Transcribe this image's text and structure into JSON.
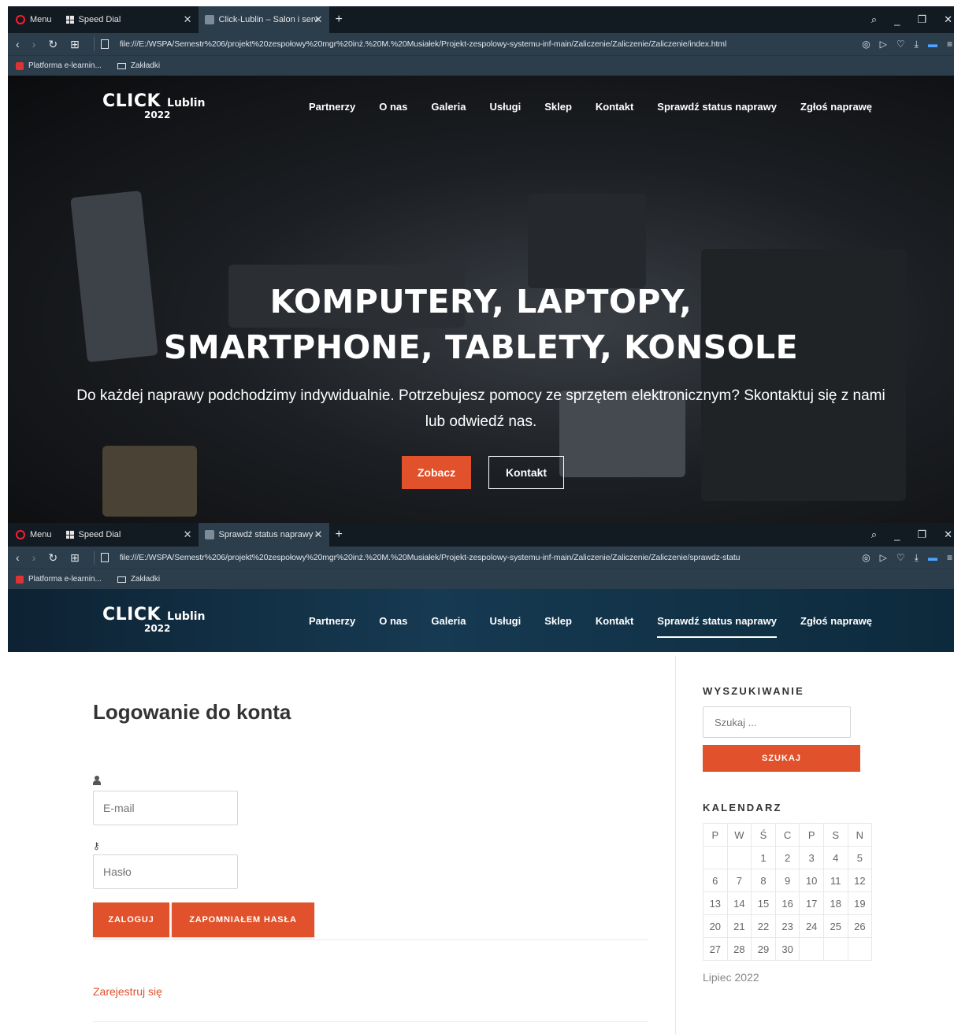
{
  "browser1": {
    "menu_label": "Menu",
    "tab1_label": "Speed Dial",
    "tab2_label": "Click-Lublin – Salon i serwis",
    "url": "file:///E:/WSPA/Semestr%206/projekt%20zespołowy%20mgr%20inż.%20M.%20Musiałek/Projekt-zespolowy-systemu-inf-main/Zaliczenie/Zaliczenie/Zaliczenie/index.html",
    "bookmark1": "Platforma e-learnin...",
    "bookmark2": "Zakładki"
  },
  "browser2": {
    "menu_label": "Menu",
    "tab1_label": "Speed Dial",
    "tab2_label": "Sprawdź status naprawy –",
    "url": "file:///E:/WSPA/Semestr%206/projekt%20zespołowy%20mgr%20inż.%20M.%20Musiałek/Projekt-zespolowy-systemu-inf-main/Zaliczenie/Zaliczenie/Zaliczenie/sprawdz-statu",
    "bookmark1": "Platforma e-learnin...",
    "bookmark2": "Zakładki"
  },
  "logo": {
    "click": "CLICK",
    "city": "Lublin",
    "year": "2022"
  },
  "nav": {
    "partnerzy": "Partnerzy",
    "onas": "O nas",
    "galeria": "Galeria",
    "uslugi": "Usługi",
    "sklep": "Sklep",
    "kontakt": "Kontakt",
    "status": "Sprawdź status naprawy",
    "zglos": "Zgłoś naprawę"
  },
  "hero": {
    "title_line1": "KOMPUTERY, LAPTOPY,",
    "title_line2": "SMARTPHONE, TABLETY, KONSOLE",
    "subtitle": "Do każdej naprawy podchodzimy indywidualnie. Potrzebujesz pomocy ze sprzętem elektronicznym? Skontaktuj się z nami lub odwiedź nas.",
    "btn_zobacz": "Zobacz",
    "btn_kontakt": "Kontakt"
  },
  "login": {
    "title": "Logowanie do konta",
    "email_placeholder": "E-mail",
    "password_placeholder": "Hasło",
    "login_btn": "ZALOGUJ",
    "forgot_btn": "ZAPOMNIAŁEM HASŁA",
    "register_link": "Zarejestruj się"
  },
  "sidebar": {
    "search_heading": "WYSZUKIWANIE",
    "search_placeholder": "Szukaj ...",
    "search_btn": "SZUKAJ",
    "calendar_heading": "KALENDARZ",
    "calendar_caption": "Lipiec 2022",
    "weekdays": [
      "P",
      "W",
      "Ś",
      "C",
      "P",
      "S",
      "N"
    ],
    "weeks": [
      [
        "",
        "",
        "1",
        "2",
        "3",
        "4",
        "5"
      ],
      [
        "6",
        "7",
        "8",
        "9",
        "10",
        "11",
        "12"
      ],
      [
        "13",
        "14",
        "15",
        "16",
        "17",
        "18",
        "19"
      ],
      [
        "20",
        "21",
        "22",
        "23",
        "24",
        "25",
        "26"
      ],
      [
        "27",
        "28",
        "29",
        "30",
        "",
        "",
        ""
      ]
    ]
  },
  "colors": {
    "accent": "#e1512b",
    "chrome_dark": "#121a22",
    "chrome_mid": "#2c3d4c"
  }
}
